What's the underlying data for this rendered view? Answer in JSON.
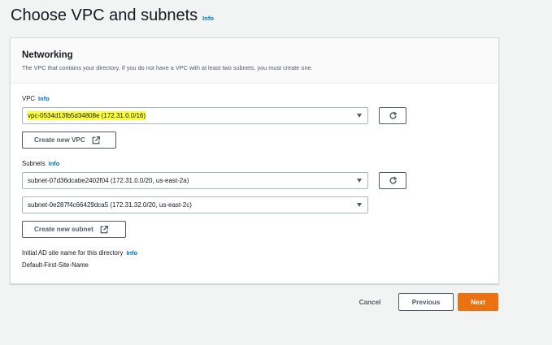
{
  "page": {
    "title": "Choose VPC and subnets",
    "info": "Info"
  },
  "networking": {
    "title": "Networking",
    "description": "The VPC that contains your directory. If you do not have a VPC with at least two subnets, you must create one.",
    "vpc": {
      "label": "VPC",
      "info": "Info",
      "selected": "vpc-0534d13fb5d34808e (172.31.0.0/16)",
      "create_button": "Create new VPC"
    },
    "subnets": {
      "label": "Subnets",
      "info": "Info",
      "subnet_1": "subnet-07d36dcabe2402f04 (172.31.0.0/20, us-east-2a)",
      "subnet_2": "subnet-0e287f4c66429dca5 (172.31.32.0/20, us-east-2c)",
      "create_button": "Create new subnet"
    },
    "ad_site": {
      "label": "Initial AD site name for this directory",
      "info": "Info",
      "value": "Default-First-Site-Name"
    }
  },
  "footer": {
    "cancel": "Cancel",
    "previous": "Previous",
    "next": "Next"
  },
  "colors": {
    "accent": "#ec7211",
    "link": "#0073bb",
    "highlight": "#fdff3a"
  },
  "icons": [
    "refresh-icon",
    "external-link-icon",
    "caret-down-icon"
  ]
}
